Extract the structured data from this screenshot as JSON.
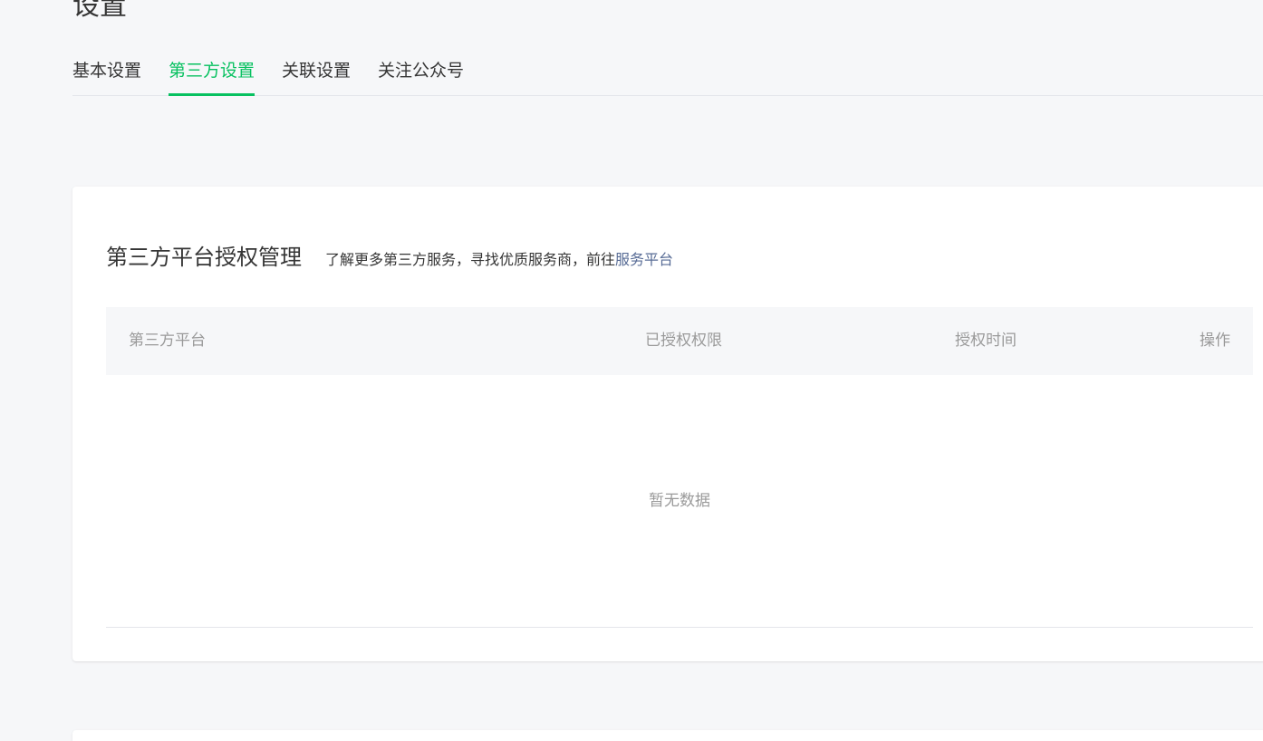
{
  "page": {
    "title": "设置"
  },
  "tabs": [
    {
      "label": "基本设置",
      "active": false
    },
    {
      "label": "第三方设置",
      "active": true
    },
    {
      "label": "关联设置",
      "active": false
    },
    {
      "label": "关注公众号",
      "active": false
    }
  ],
  "third_party": {
    "title": "第三方平台授权管理",
    "description": "了解更多第三方服务，寻找优质服务商，前往",
    "link_label": "服务平台",
    "table": {
      "columns": [
        "第三方平台",
        "已授权权限",
        "授权时间",
        "操作"
      ],
      "rows": [],
      "empty_text": "暂无数据"
    }
  },
  "colors": {
    "accent": "#07c160",
    "link": "#576b95",
    "background": "#f6f7f9",
    "muted_text": "#9a9a9a"
  }
}
